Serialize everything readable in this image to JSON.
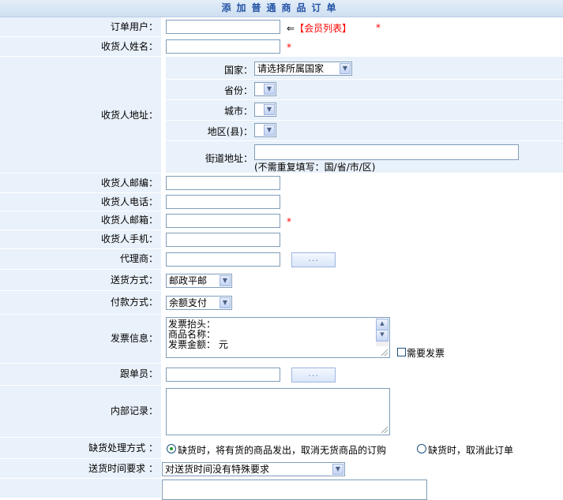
{
  "title": "添加普通商品订单",
  "order_user": {
    "label": "订单用户：",
    "arrow": "⇐",
    "bracket_open": "【",
    "link": "会员列表",
    "bracket_close": "】",
    "required": "*"
  },
  "receiver_name": {
    "label": "收货人姓名：",
    "required": "*"
  },
  "address": {
    "label": "收货人地址：",
    "country": {
      "label": "国家：",
      "value": "请选择所属国家"
    },
    "province": {
      "label": "省份：",
      "value": ""
    },
    "city": {
      "label": "城市：",
      "value": ""
    },
    "district": {
      "label": "地区(县)：",
      "value": ""
    },
    "street": {
      "label": "街道地址：",
      "hint": "(不需重复填写：国/省/市/区)"
    }
  },
  "zipcode": {
    "label": "收货人邮编："
  },
  "phone": {
    "label": "收货人电话："
  },
  "email": {
    "label": "收货人邮箱：",
    "required": "*"
  },
  "mobile": {
    "label": "收货人手机："
  },
  "agent": {
    "label": "代理商：",
    "button": "..."
  },
  "delivery": {
    "label": "送货方式：",
    "value": "邮政平邮"
  },
  "payment": {
    "label": "付款方式：",
    "value": "余额支付"
  },
  "invoice": {
    "label": "发票信息：",
    "lines": [
      "发票抬头：",
      "商品名称：",
      "发票金额：  元"
    ],
    "checkbox_label": "需要发票",
    "checked": false
  },
  "follower": {
    "label": "跟单员：",
    "button": "..."
  },
  "notes": {
    "label": "内部记录：",
    "value": ""
  },
  "stockout": {
    "label": "缺货处理方式 ：",
    "options": [
      {
        "text": "缺货时，将有货的商品发出，取消无货商品的订购",
        "selected": true
      },
      {
        "text": "缺货时，取消此订单",
        "selected": false
      }
    ]
  },
  "delivery_time": {
    "label": "送货时间要求 ：",
    "value": "对送货时间没有特殊要求"
  }
}
